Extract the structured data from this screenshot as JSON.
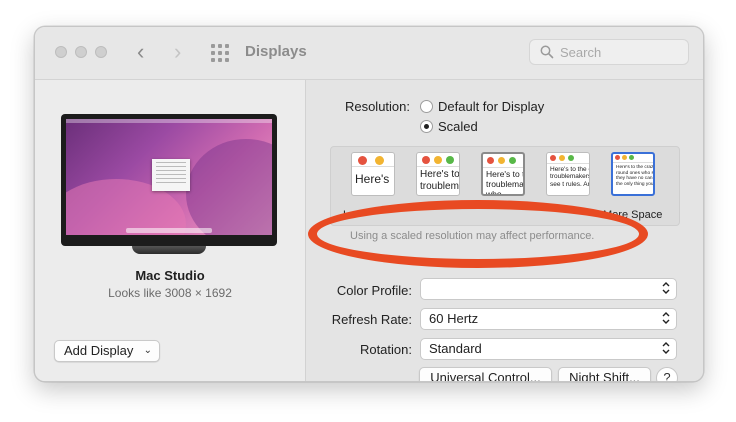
{
  "window": {
    "title": "Displays",
    "search_placeholder": "Search"
  },
  "display": {
    "name": "Mac Studio",
    "looks_like": "Looks like 3008 × 1692",
    "add_display_label": "Add Display"
  },
  "resolution": {
    "label": "Resolution:",
    "options": [
      "Default for Display",
      "Scaled"
    ],
    "selected": "Scaled",
    "scale_thumbnails": [
      {
        "text": "Here's"
      },
      {
        "text": "Here's to troublem"
      },
      {
        "text": "Here's to t troublema ones who"
      },
      {
        "text": "Here's to the cr troublemakers. ones who see t rules. And they"
      },
      {
        "text": "Here's to the crazy one troublemakers. The round ones who see things diffe rules. And they have no can quote them, disagree About the only thing you Because they change thi"
      }
    ],
    "scale_labels": {
      "left": "L",
      "right": "More Space"
    },
    "warning": "Using a scaled resolution may affect performance."
  },
  "color_profile": {
    "label": "Color Profile:",
    "value": ""
  },
  "refresh_rate": {
    "label": "Refresh Rate:",
    "value": "60 Hertz"
  },
  "rotation": {
    "label": "Rotation:",
    "value": "Standard"
  },
  "buttons": {
    "universal_control": "Universal Control...",
    "night_shift": "Night Shift...",
    "help": "?"
  },
  "colors": {
    "annotation_oval": "#e84a22",
    "selected_thumb_border": "#3a70d8"
  }
}
